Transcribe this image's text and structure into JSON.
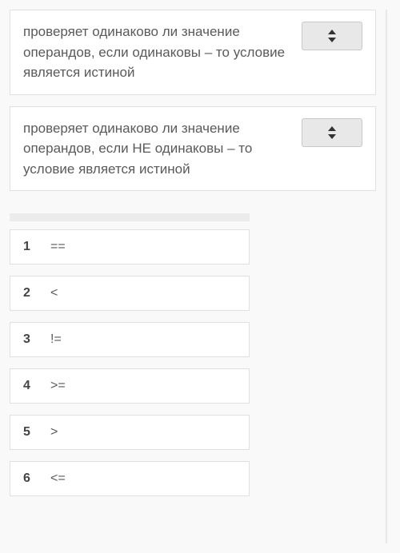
{
  "questions": [
    {
      "text": "проверяет одинаково ли значение операндов, если одинаковы – то условие является истиной"
    },
    {
      "text": "проверяет одинаково ли значение операндов, если НЕ одинаковы – то условие является истиной"
    }
  ],
  "options": [
    {
      "num": "1",
      "symbol": "=="
    },
    {
      "num": "2",
      "symbol": "<"
    },
    {
      "num": "3",
      "symbol": "!="
    },
    {
      "num": "4",
      "symbol": ">="
    },
    {
      "num": "5",
      "symbol": ">"
    },
    {
      "num": "6",
      "symbol": "<="
    }
  ]
}
